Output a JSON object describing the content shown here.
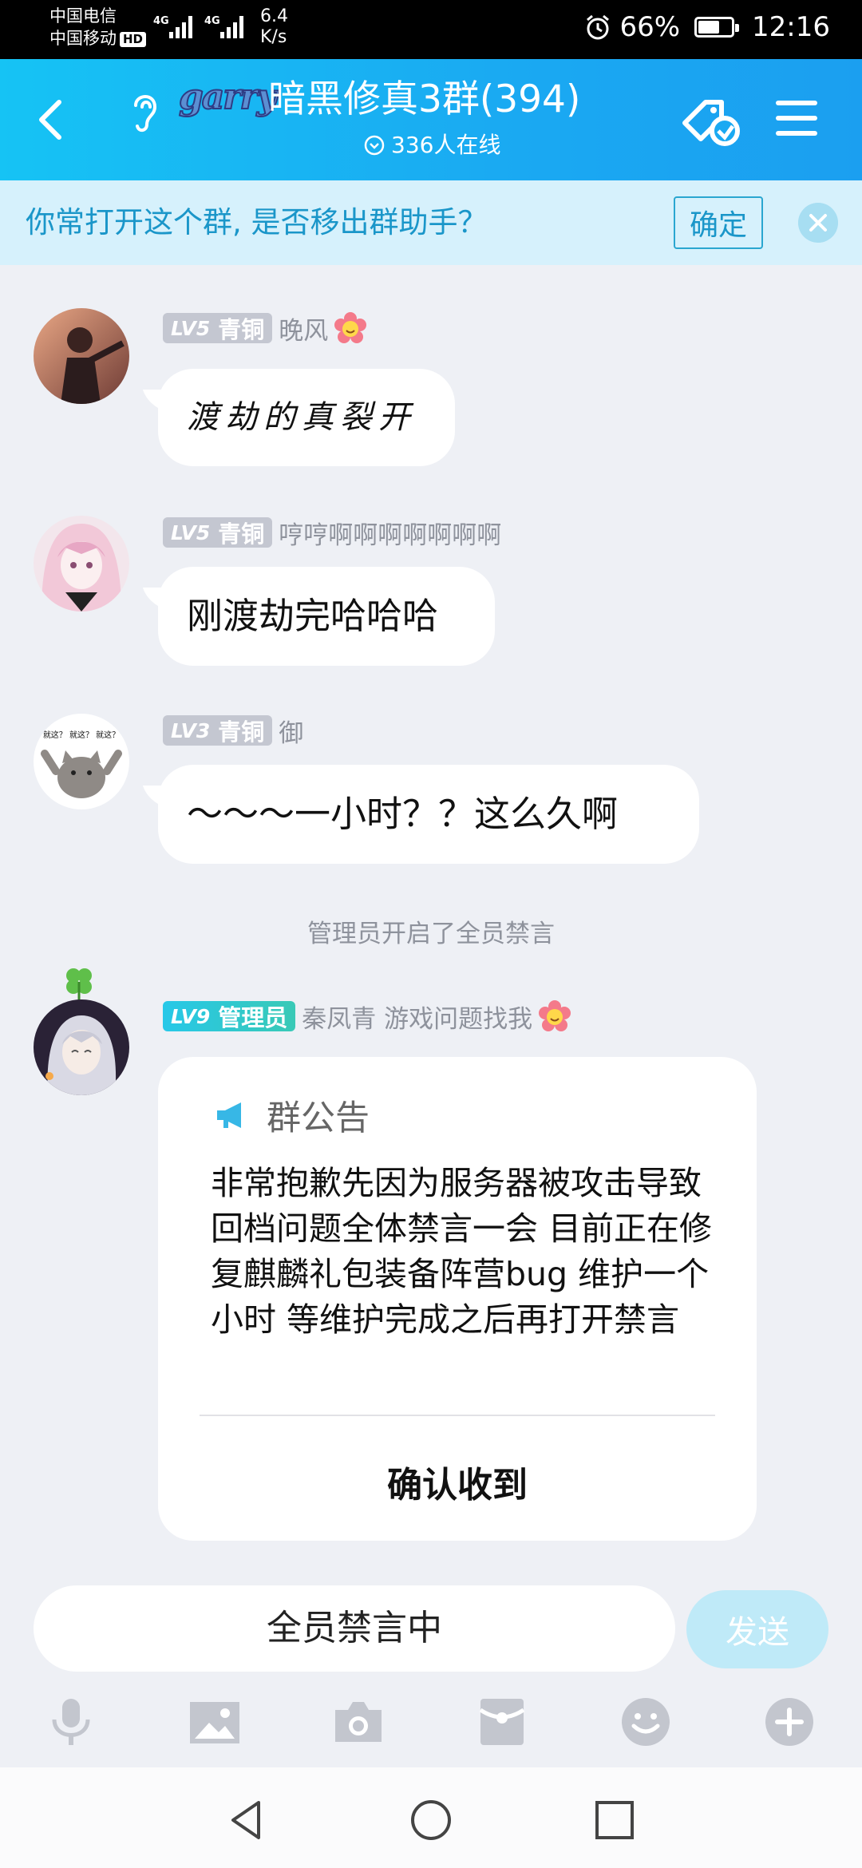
{
  "status_bar": {
    "carrier_1": "中国电信",
    "carrier_2": "中国移动",
    "hd_badge": "HD",
    "net_speed_value": "6.4",
    "net_speed_unit": "K/s",
    "battery_percent": "66%",
    "battery_level": 0.66,
    "time": "12:16"
  },
  "header": {
    "badge_text": "garry",
    "group_title": "暗黑修真3群(394)",
    "online_count": "336人在线"
  },
  "banner": {
    "text": "你常打开这个群, 是否移出群助手？",
    "confirm_label": "确定"
  },
  "messages": [
    {
      "level": "LV5",
      "rank": "青铜",
      "nickname": "晚风",
      "text": "渡劫的真裂开"
    },
    {
      "level": "LV5",
      "rank": "青铜",
      "nickname": "哼哼啊啊啊啊啊啊啊",
      "text": "刚渡劫完哈哈哈"
    },
    {
      "level": "LV3",
      "rank": "青铜",
      "nickname": "御",
      "text": "～～～一小时？？这么久啊",
      "avatar_caption": "就这？ 就这？ 就这？"
    }
  ],
  "system_message": "管理员开启了全员禁言",
  "admin_message": {
    "level": "LV9",
    "rank": "管理员",
    "nickname": "秦凤青 游戏问题找我",
    "notice_title": "群公告",
    "notice_body": "非常抱歉先因为服务器被攻击导致回档问题全体禁言一会 目前正在修复麒麟礼包装备阵营bug 维护一个小时 等维护完成之后再打开禁言",
    "ack_label": "确认收到"
  },
  "input": {
    "muted_text": "全员禁言中",
    "send_label": "发送"
  },
  "toolbar": {
    "icons": [
      "microphone-icon",
      "image-icon",
      "camera-icon",
      "red-packet-icon",
      "emoji-icon",
      "plus-icon"
    ]
  },
  "colors": {
    "header_blue": "#1aa9f2",
    "banner_bg": "#d6f1fc",
    "banner_text": "#1a96c9",
    "chat_bg": "#eef0f5",
    "send_disabled": "#bfeaf8"
  }
}
